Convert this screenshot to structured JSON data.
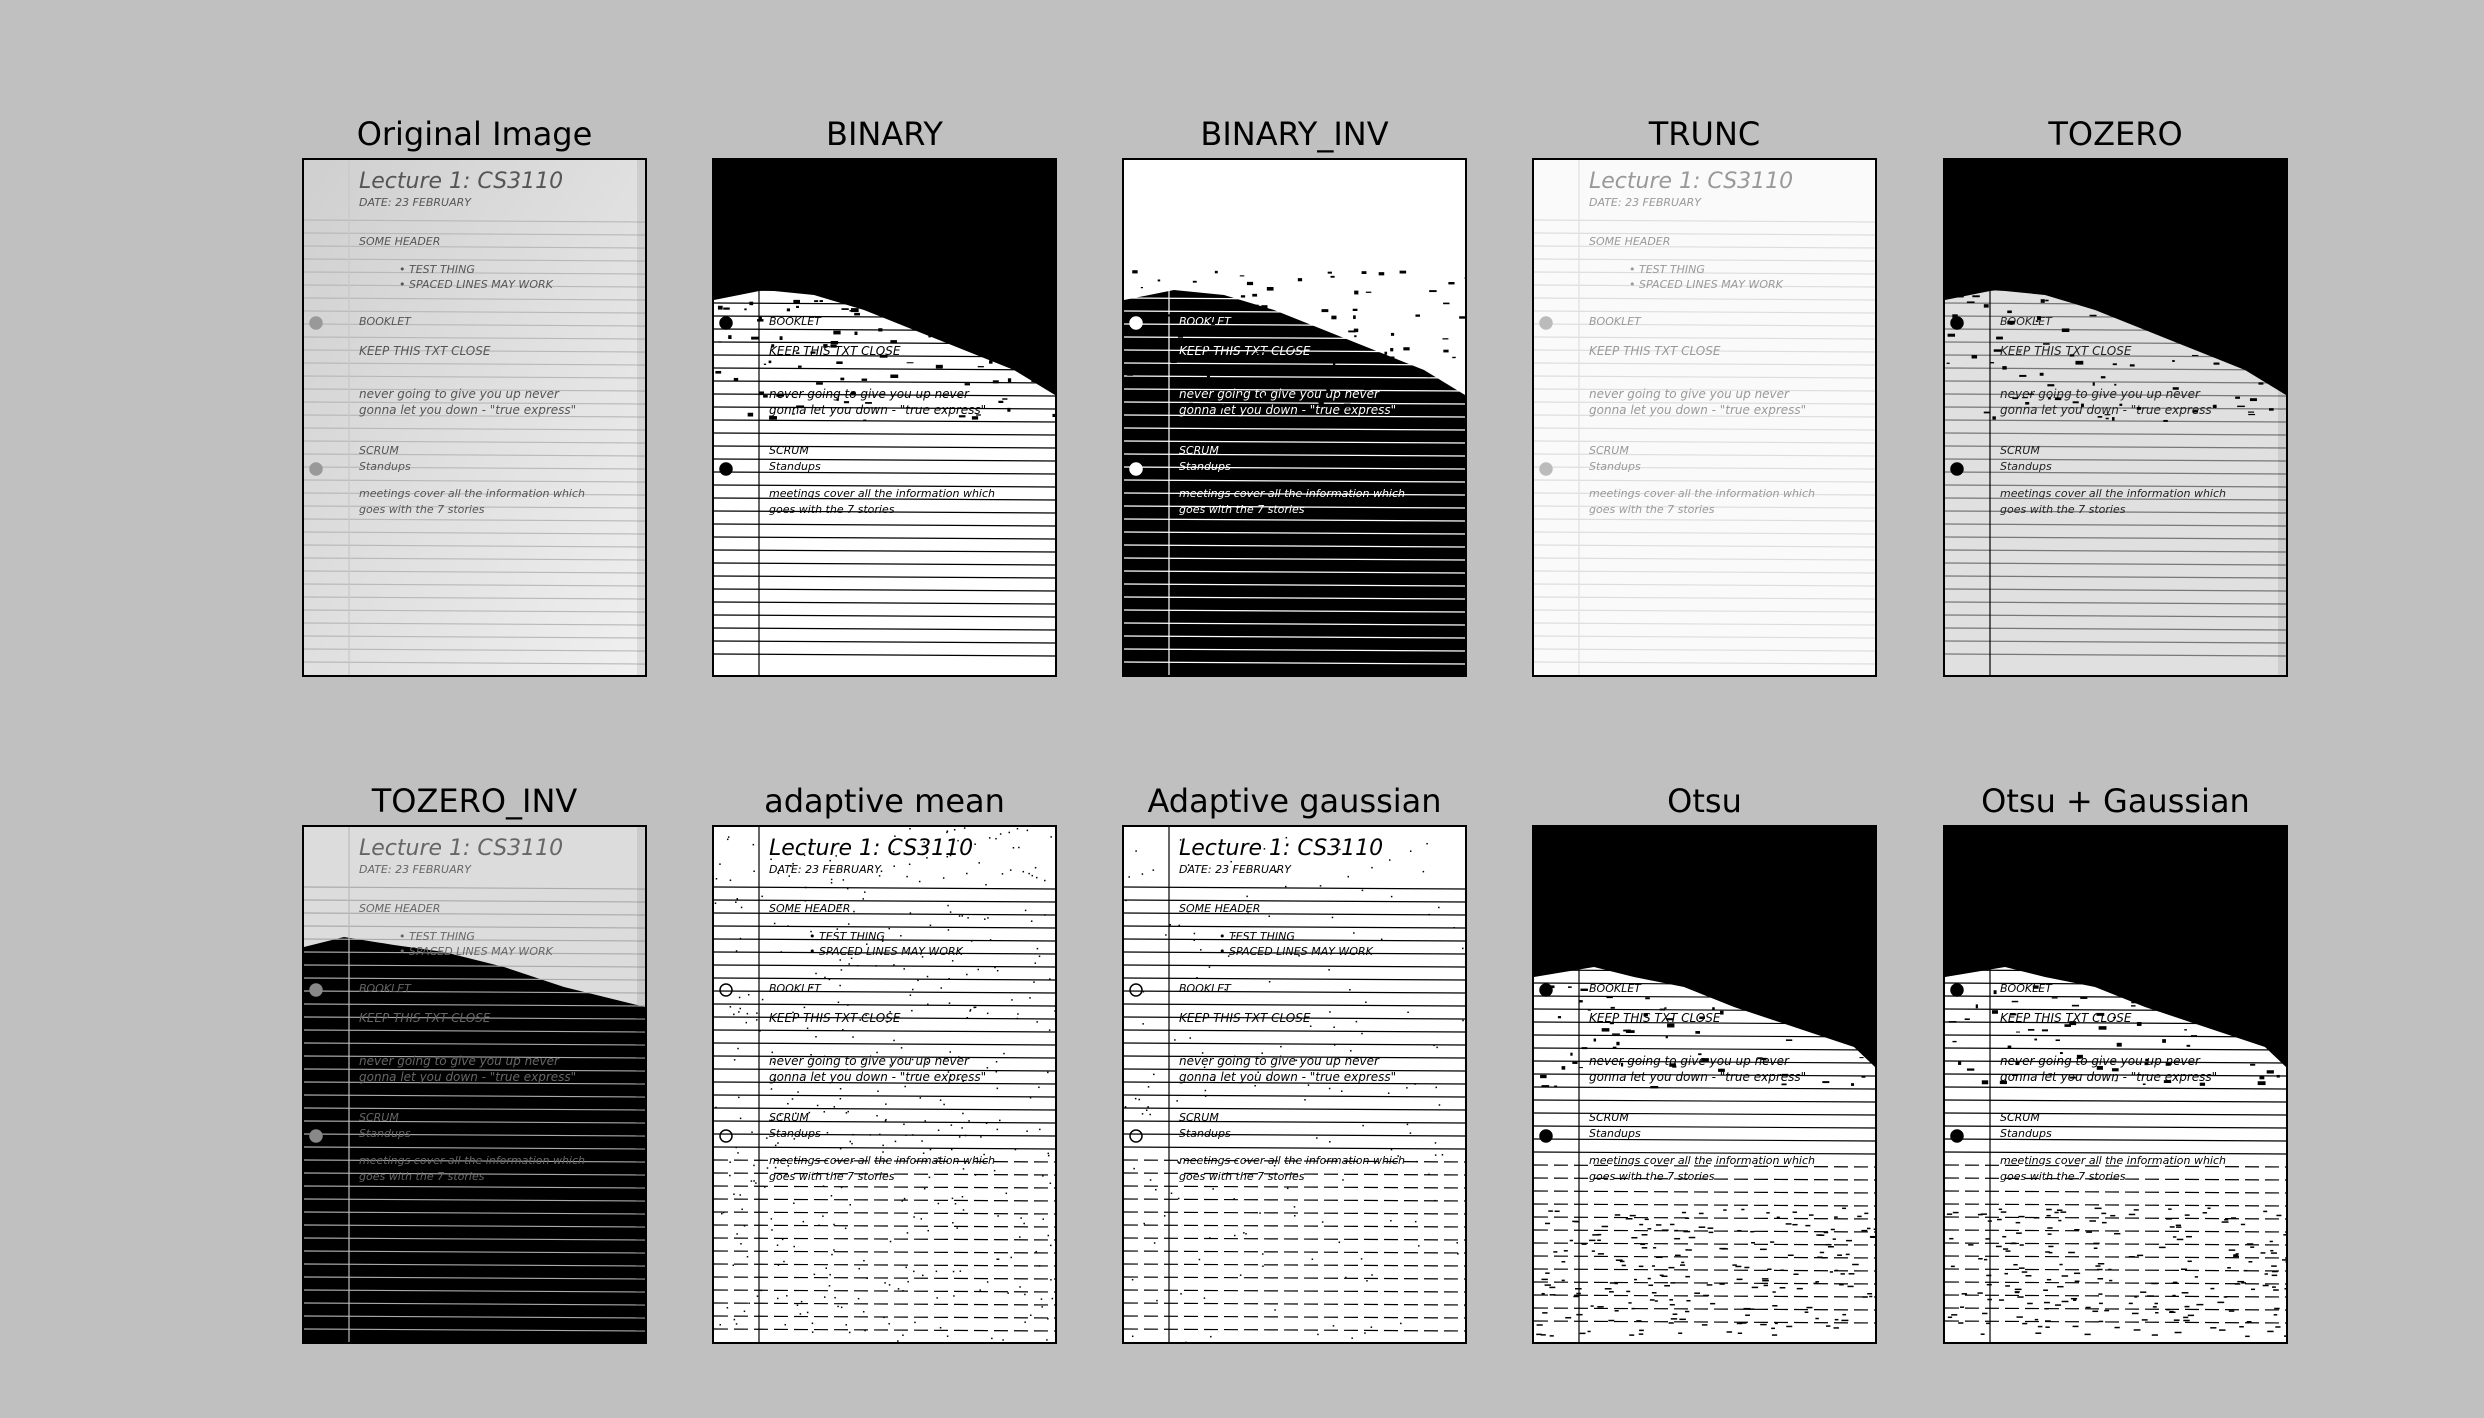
{
  "figure": {
    "background": "#c0c0c0",
    "panels": [
      {
        "title": "Original Image",
        "style": "gray"
      },
      {
        "title": "BINARY",
        "style": "binary"
      },
      {
        "title": "BINARY_INV",
        "style": "binary_inv"
      },
      {
        "title": "TRUNC",
        "style": "trunc"
      },
      {
        "title": "TOZERO",
        "style": "tozero"
      },
      {
        "title": "TOZERO_INV",
        "style": "tozero_inv"
      },
      {
        "title": "adaptive mean",
        "style": "adaptive_mean"
      },
      {
        "title": "Adaptive gaussian",
        "style": "adaptive_gauss"
      },
      {
        "title": "Otsu",
        "style": "otsu"
      },
      {
        "title": "Otsu + Gaussian",
        "style": "otsu_gauss"
      }
    ]
  },
  "note_lines": [
    "Lecture 1: CS3110",
    "DATE: 23 FEBRUARY",
    "SOME HEADER",
    "• TEST THING",
    "• SPACED LINES MAY WORK",
    "BOOKLET",
    "KEEP THIS TXT CLOSE",
    "never going to give you up never",
    "gonna let you down - \"true express\"",
    "SCRUM",
    "Standups",
    "meetings cover all the information which",
    "goes with the 7 stories"
  ]
}
